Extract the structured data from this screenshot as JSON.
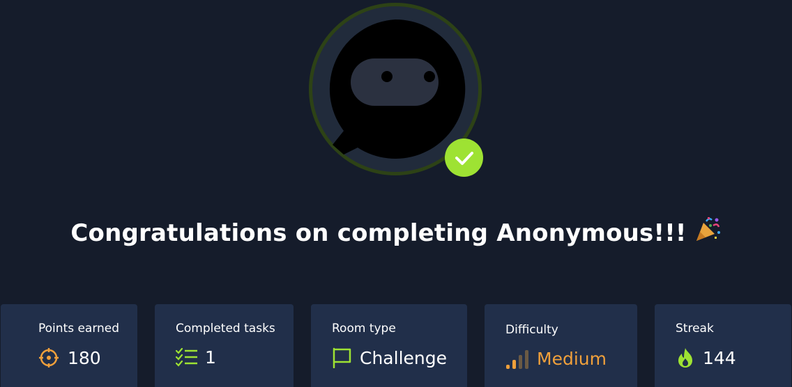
{
  "headline": {
    "text": "Congratulations on completing Anonymous!!!",
    "emoji": "party-popper-icon"
  },
  "stats": {
    "points": {
      "label": "Points earned",
      "value": "180",
      "icon": "crosshair-icon"
    },
    "tasks": {
      "label": "Completed tasks",
      "value": "1",
      "icon": "checklist-icon"
    },
    "room_type": {
      "label": "Room type",
      "value": "Challenge",
      "icon": "flag-icon"
    },
    "difficulty": {
      "label": "Difficulty",
      "value": "Medium",
      "icon": "signal-bars-icon",
      "color": "#f0a03b"
    },
    "streak": {
      "label": "Streak",
      "value": "144",
      "icon": "flame-icon"
    }
  },
  "colors": {
    "background": "#151c2b",
    "card": "#212f4a",
    "accent_green": "#9ee233",
    "accent_orange": "#f0a03b"
  }
}
